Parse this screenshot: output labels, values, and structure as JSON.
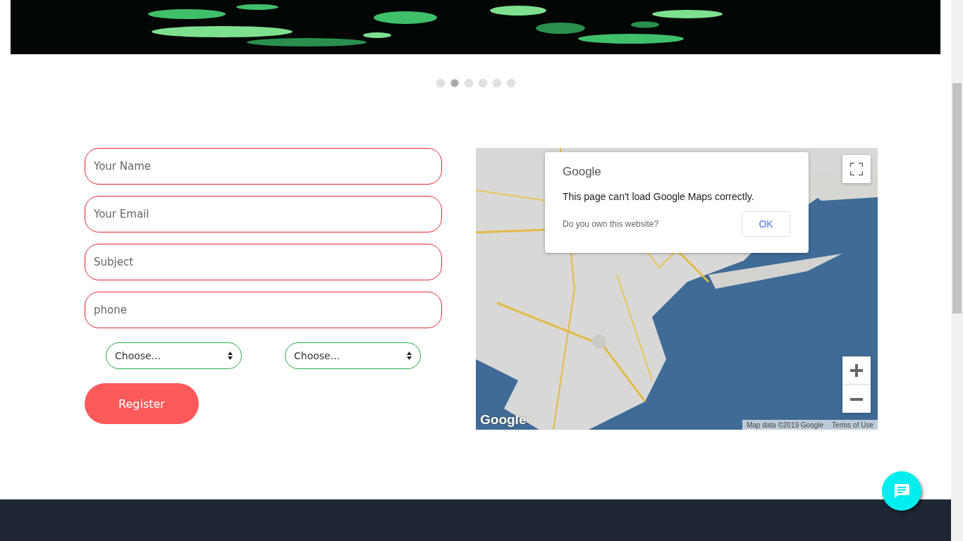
{
  "carousel": {
    "dots": [
      {
        "selected": false
      },
      {
        "selected": true
      },
      {
        "selected": false
      },
      {
        "selected": false
      },
      {
        "selected": false
      },
      {
        "selected": false
      }
    ]
  },
  "form": {
    "fields": [
      {
        "placeholder": "Your Name"
      },
      {
        "placeholder": "Your Email"
      },
      {
        "placeholder": "Subject"
      },
      {
        "placeholder": "phone"
      }
    ],
    "selects": [
      {
        "value": "Choose..."
      },
      {
        "value": "Choose..."
      }
    ],
    "submit": "Register"
  },
  "map": {
    "kind": "picture",
    "dialog": {
      "logo": "Google",
      "message": "This page can't load Google Maps correctly.",
      "link": "Do you own this website?",
      "button": "OK"
    },
    "logo": "Google",
    "attribution": "Map data ©2019 Google",
    "terms": "Terms of Use"
  }
}
